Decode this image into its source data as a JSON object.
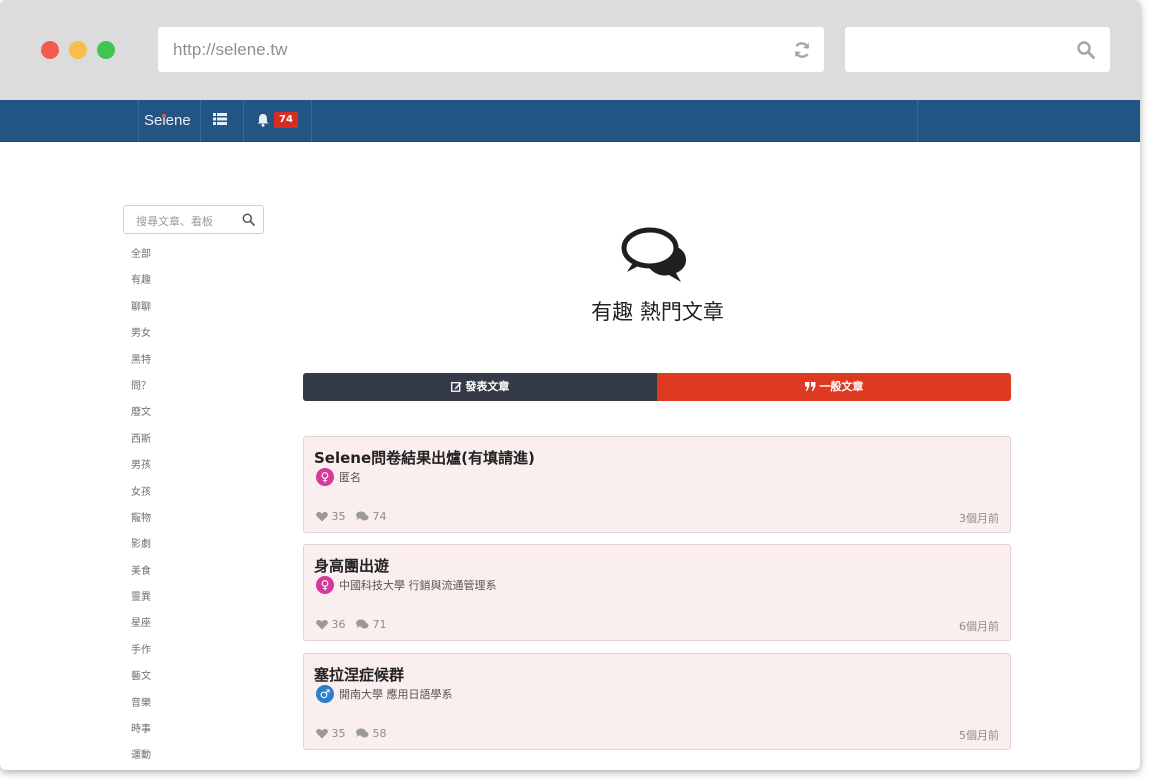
{
  "browser": {
    "url": "http://selene.tw",
    "search_value": ""
  },
  "navbar": {
    "brand": "Selene",
    "notification_count": "74"
  },
  "sidebar": {
    "search_placeholder": "搜尋文章、看板",
    "items": [
      "全部",
      "有趣",
      "聊聊",
      "男女",
      "黑特",
      "問？",
      "廢文",
      "西斯",
      "男孩",
      "女孩",
      "寵物",
      "影劇",
      "美食",
      "靈異",
      "星座",
      "手作",
      "藝文",
      "音樂",
      "時事",
      "運動"
    ]
  },
  "main": {
    "heading": "有趣 熱門文章",
    "tabs": [
      {
        "label": "發表文章",
        "icon": "edit-icon"
      },
      {
        "label": "一般文章",
        "icon": "quote-icon"
      }
    ],
    "posts": [
      {
        "title": "Selene問卷結果出爐(有填請進)",
        "gender": "female",
        "author": "匿名",
        "likes": "35",
        "comments": "74",
        "time": "3個月前"
      },
      {
        "title": "身高團出遊",
        "gender": "female",
        "author": "中國科技大學 行銷與流通管理系",
        "likes": "36",
        "comments": "71",
        "time": "6個月前"
      },
      {
        "title": "塞拉涅症候群",
        "gender": "male",
        "author": "開南大學 應用日語學系",
        "likes": "35",
        "comments": "58",
        "time": "5個月前"
      }
    ]
  },
  "colors": {
    "navbar": "#235584",
    "tab_post": "#343a46",
    "tab_general": "#de3a22",
    "card_bg": "#fbeeee",
    "female": "#d6399a",
    "male": "#2b80c9"
  }
}
